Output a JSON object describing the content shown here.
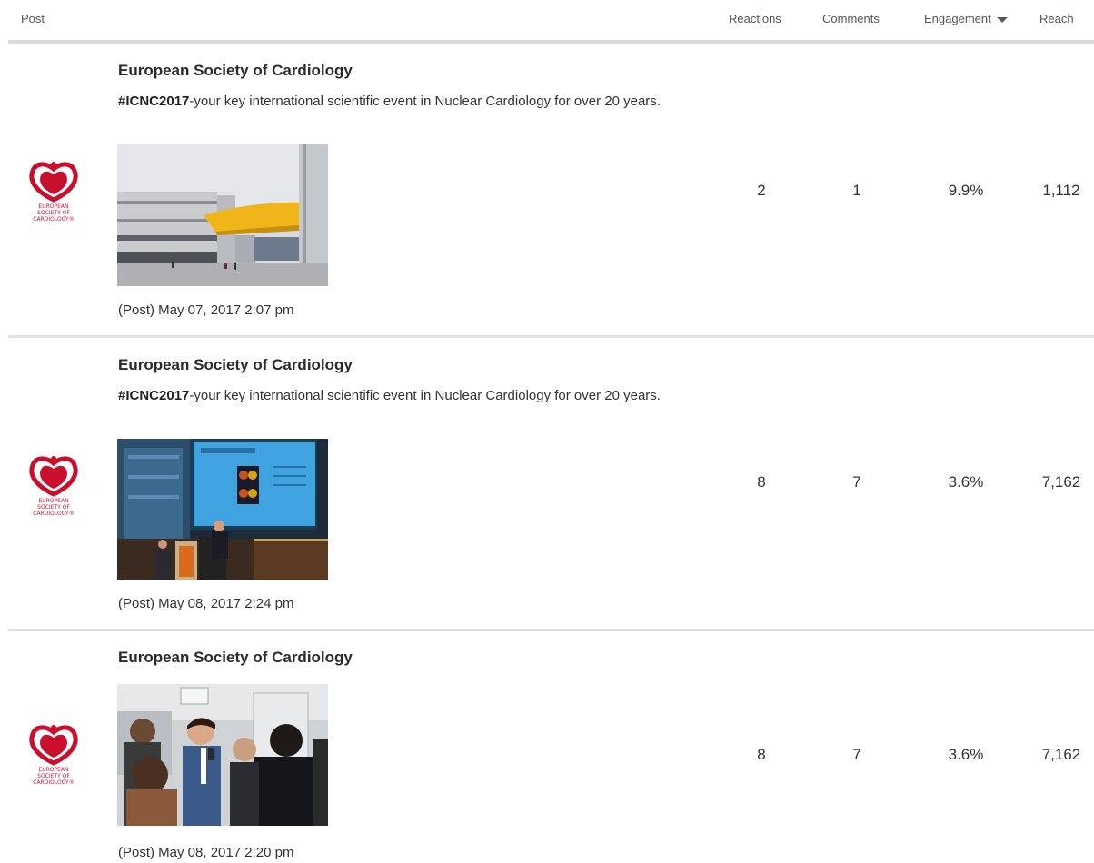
{
  "header": {
    "post": "Post",
    "reactions": "Reactions",
    "comments": "Comments",
    "engagement": "Engagement",
    "reach": "Reach"
  },
  "logo_text": "EUROPEAN SOCIETY OF CARDIOLOGY®",
  "colors": {
    "brand_red": "#c8102e",
    "rule": "#e2e2e2"
  },
  "posts": [
    {
      "author": "European Society of Cardiology",
      "hashtag": "#ICNC2017",
      "caption": "-your key international scientific event in Nuclear Cardiology for over 20 years.",
      "timestamp": "(Post) May 07, 2017 2:07 pm",
      "reactions": "2",
      "comments": "1",
      "engagement": "9.9%",
      "reach": "1,112"
    },
    {
      "author": "European Society of Cardiology",
      "hashtag": "#ICNC2017",
      "caption": "-your key international scientific event in Nuclear Cardiology for over 20 years.",
      "timestamp": "(Post) May 08, 2017 2:24 pm",
      "reactions": "8",
      "comments": "7",
      "engagement": "3.6%",
      "reach": "7,162"
    },
    {
      "author": "European Society of Cardiology",
      "hashtag": "",
      "caption": "",
      "timestamp": "(Post) May 08, 2017 2:20 pm",
      "reactions": "8",
      "comments": "7",
      "engagement": "3.6%",
      "reach": "7,162"
    }
  ]
}
